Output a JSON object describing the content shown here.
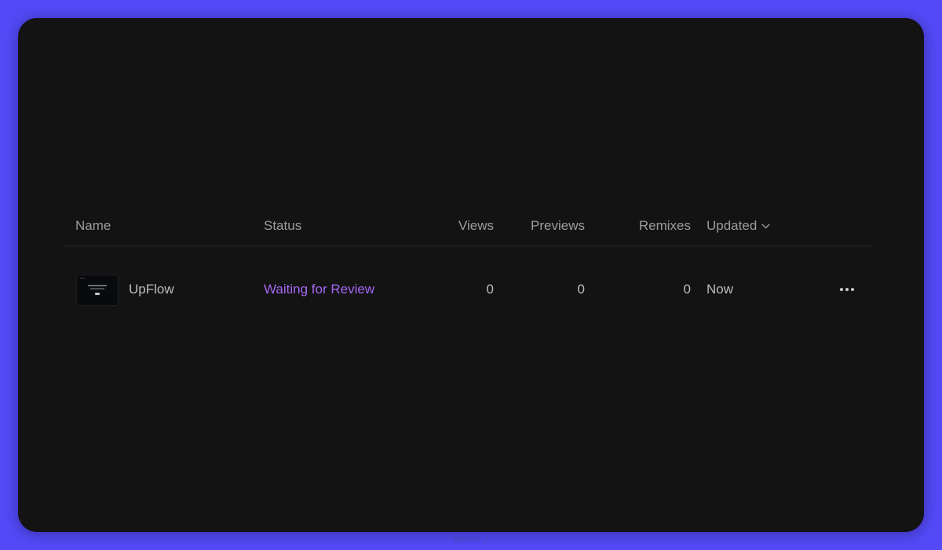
{
  "table": {
    "headers": {
      "name": "Name",
      "status": "Status",
      "views": "Views",
      "previews": "Previews",
      "remixes": "Remixes",
      "updated": "Updated"
    },
    "sort_icon": "chevron-down-icon",
    "rows": [
      {
        "name": "UpFlow",
        "status": "Waiting for Review",
        "views": "0",
        "previews": "0",
        "remixes": "0",
        "updated": "Now",
        "actions_icon": "more-horizontal-icon"
      }
    ]
  },
  "colors": {
    "background": "#5349f7",
    "card": "#131313",
    "status_accent": "#a568f2"
  },
  "footer": {
    "watermark": "@jbcode_it"
  }
}
